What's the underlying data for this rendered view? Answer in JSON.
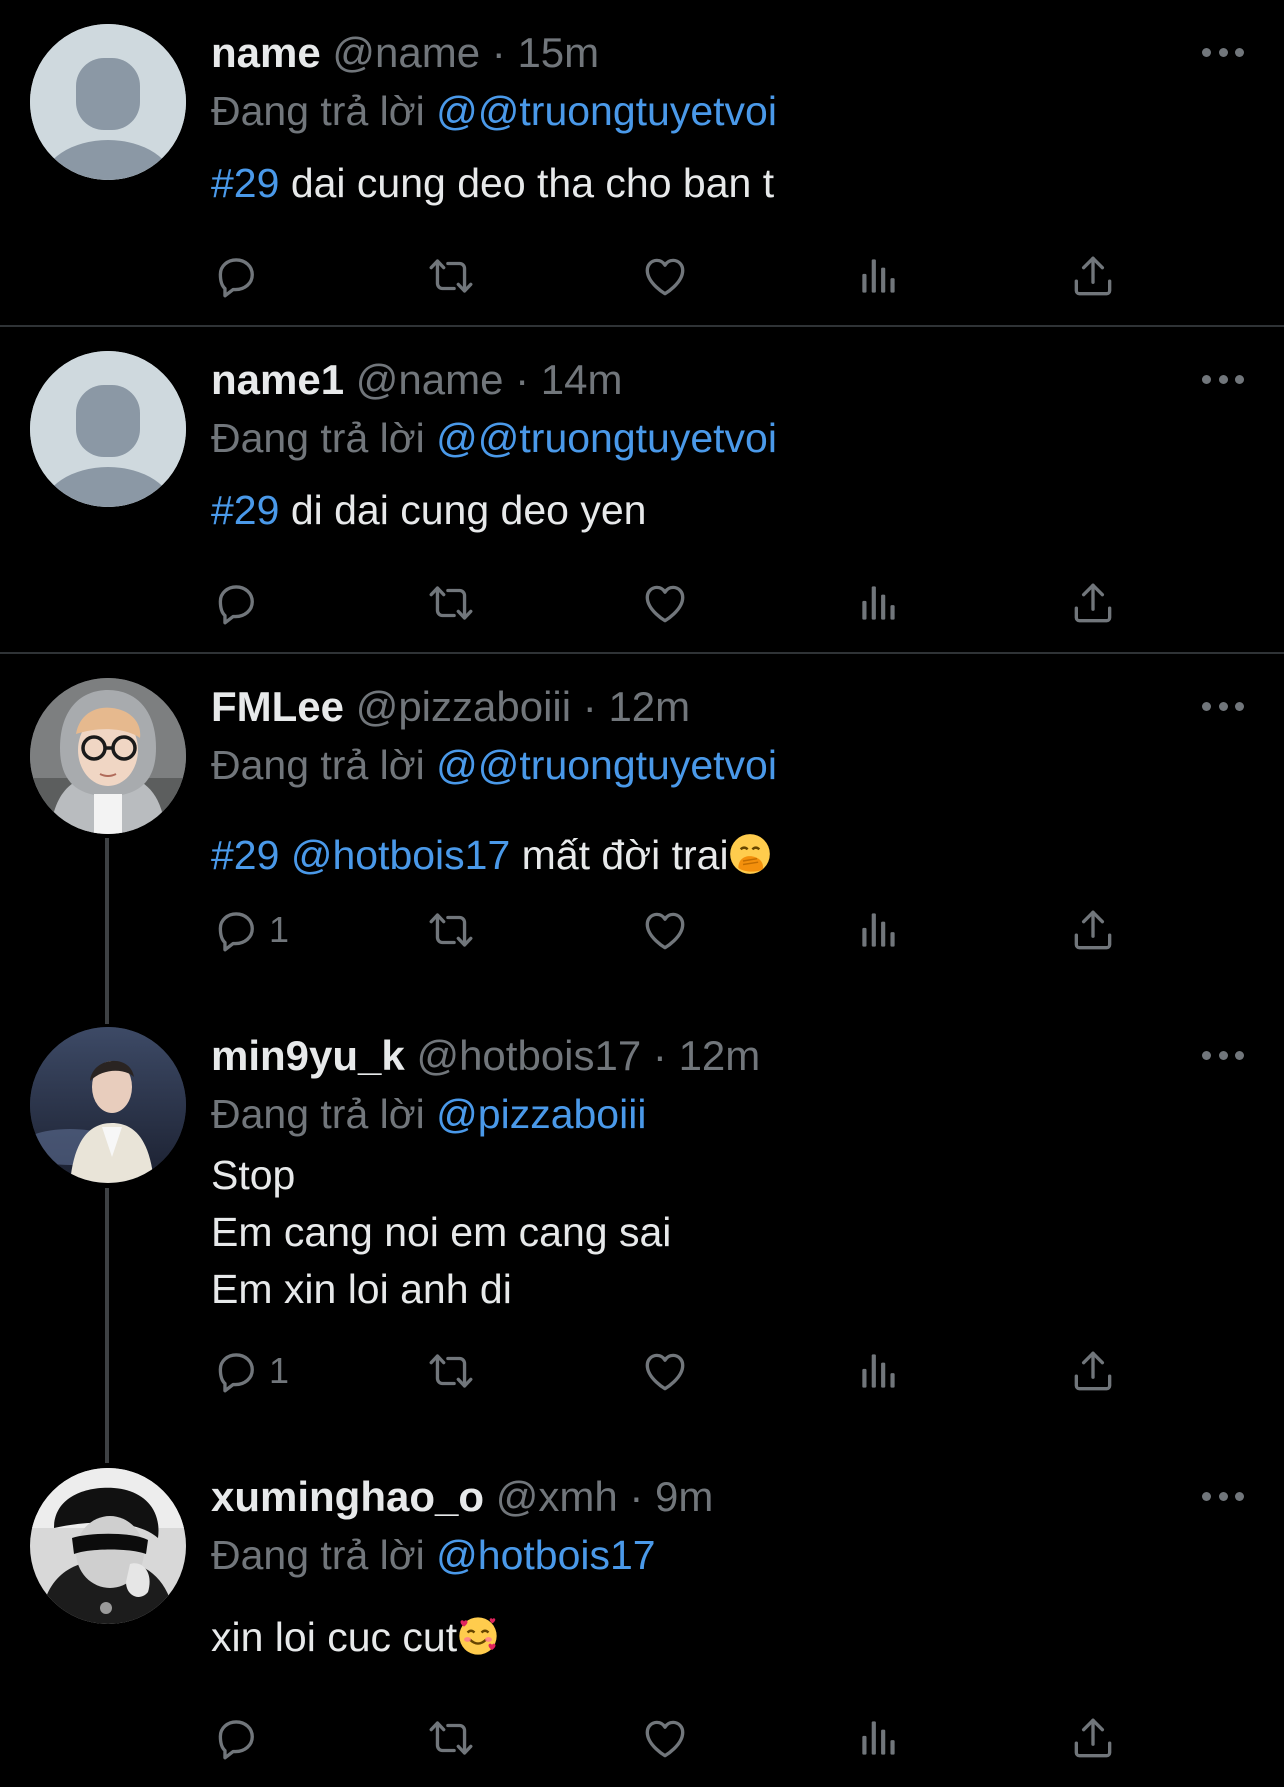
{
  "reply_prefix": "Đang trả lời",
  "tweets": [
    {
      "display_name": "name",
      "handle": "@name",
      "separator": "·",
      "time": "15m",
      "reply_to": "@@truongtuyetvoi",
      "hashtag": "#29",
      "text": "dai cung deo tha cho ban t",
      "reply_count": ""
    },
    {
      "display_name": "name1",
      "handle": "@name",
      "separator": "·",
      "time": "14m",
      "reply_to": "@@truongtuyetvoi",
      "hashtag": "#29",
      "text": "di dai cung deo yen",
      "reply_count": ""
    },
    {
      "display_name": "FMLee",
      "handle": "@pizzaboiii",
      "separator": "·",
      "time": "12m",
      "reply_to": "@@truongtuyetvoi",
      "hashtag": "#29",
      "mention": "@hotbois17",
      "text": "mất đời trai",
      "emoji": "hand-over-mouth-emoji",
      "reply_count": "1"
    },
    {
      "display_name": "min9yu_k",
      "handle": "@hotbois17",
      "separator": "·",
      "time": "12m",
      "reply_to": "@pizzaboiii",
      "lines": [
        "Stop",
        "Em cang noi em cang sai",
        "Em xin loi anh di"
      ],
      "reply_count": "1"
    },
    {
      "display_name": "xuminghao_o",
      "handle": "@xmh",
      "separator": "·",
      "time": "9m",
      "reply_to": "@hotbois17",
      "text": "xin loi cuc cut",
      "emoji": "smiling-face-with-hearts-emoji",
      "reply_count": ""
    }
  ],
  "icons": [
    "reply-icon",
    "retweet-icon",
    "like-icon",
    "views-icon",
    "share-icon",
    "more-icon"
  ],
  "colors": {
    "background": "#000000",
    "text": "#e7e9ea",
    "secondary": "#71767b",
    "link": "#4a99e9",
    "divider": "#2f3336"
  }
}
